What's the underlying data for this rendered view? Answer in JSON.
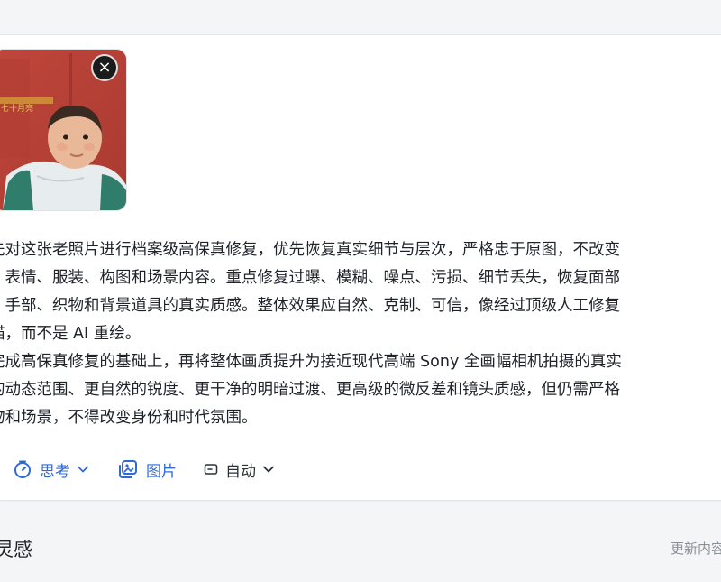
{
  "prompt": {
    "lines": [
      "先对这张老照片进行档案级高保真修复，优先恢复真实细节与层次，严格忠于原图，不改变",
      "、表情、服装、构图和场景内容。重点修复过曝、模糊、噪点、污损、细节丢失，恢复面部",
      "、手部、织物和背景道具的真实质感。整体效果应自然、克制、可信，像经过顶级人工修复",
      "描，而不是 AI 重绘。",
      "完成高保真修复的基础上，再将整体画质提升为接近现代高端 Sony 全画幅相机拍摄的真实",
      "的动态范围、更自然的锐度、更干净的明暗过渡、更高级的微反差和镜头质感，但仍需严格",
      "物和场景，不得改变身份和时代氛围。"
    ]
  },
  "attachment": {
    "close_symbol": "×",
    "poster_text": "七十月亮"
  },
  "toolbar": {
    "think_label": "思考",
    "image_label": "图片",
    "auto_label": "自动"
  },
  "footer": {
    "inspire_label": "灵感",
    "refresh_label": "更新内容"
  },
  "colors": {
    "accent": "#2f6bd8",
    "text": "#1f2329",
    "muted": "#8a8f98"
  },
  "icons": {
    "think": "timer-icon",
    "image": "images-icon",
    "auto": "model-icon",
    "dropdown": "chevron-down-icon",
    "close": "close-icon"
  }
}
